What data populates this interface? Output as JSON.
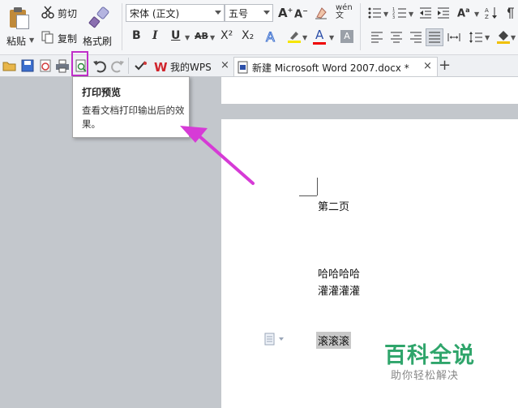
{
  "ribbon": {
    "paste_label": "粘贴",
    "cut_label": "剪切",
    "copy_label": "复制",
    "format_painter_label": "格式刷",
    "font_name": "宋体 (正文)",
    "font_size": "五号",
    "bold_glyph": "B",
    "italic_glyph": "I",
    "underline_glyph": "U",
    "strike_glyph": "AB",
    "superscript_glyph": "X²",
    "subscript_glyph": "X₂",
    "font_color_glyph": "A"
  },
  "tabs": {
    "wps_label": "我的WPS",
    "doc_label": "新建 Microsoft Word 2007.docx *",
    "close_glyph": "×",
    "new_tab_glyph": "+"
  },
  "tooltip": {
    "title": "打印预览",
    "description": "查看文档打印输出后的效果。"
  },
  "document": {
    "line1": "第二页",
    "line2": "哈哈哈哈",
    "line3": "灌灌灌灌",
    "line4": "滚滚滚"
  },
  "watermark": {
    "title": "百科全说",
    "subtitle": "助你轻松解决"
  },
  "colors": {
    "highlight": "#c02fc9",
    "arrow": "#d63bd6",
    "watermark": "#2fa56b"
  }
}
